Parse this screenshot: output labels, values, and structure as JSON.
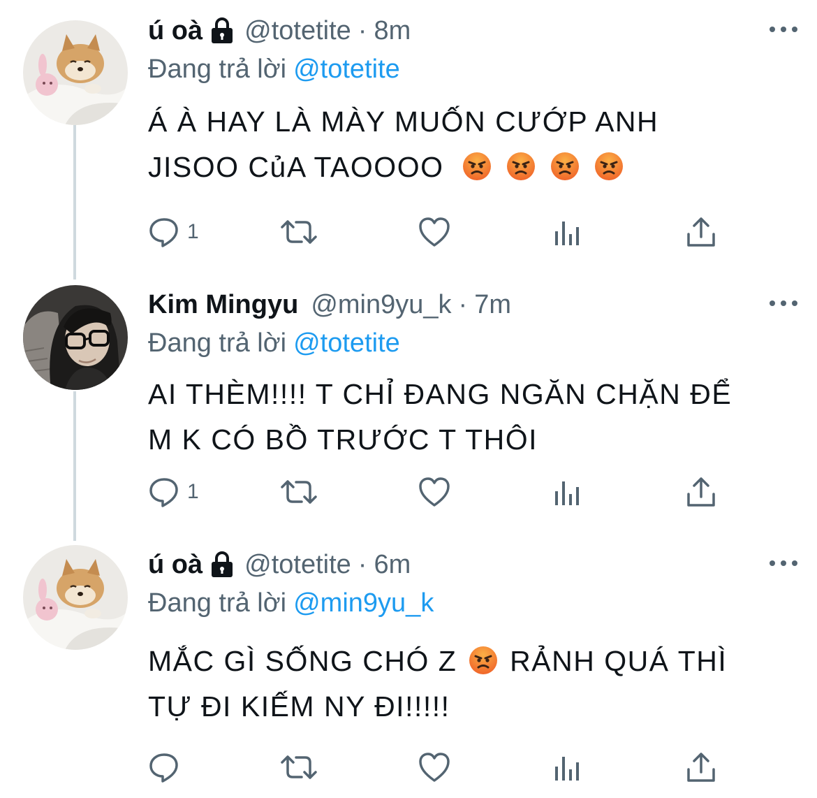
{
  "tweets": [
    {
      "name": "ú oà",
      "handle": "@totetite",
      "separator": "·",
      "time": "8m",
      "replying_prefix": "Đang trả lời",
      "replying_to": "@totetite",
      "text_line1": "Á À HAY LÀ MÀY MUỐN CƯỚP ANH",
      "text_line2": "JISOO CủA TAOOOO",
      "reply_count": "1",
      "avatar": "shiba-dog-avatar",
      "locked": true
    },
    {
      "name": "Kim Mingyu",
      "handle": "@min9yu_k",
      "separator": "·",
      "time": "7m",
      "replying_prefix": "Đang trả lời",
      "replying_to": "@totetite",
      "text_line1": "AI THÈM!!!! T CHỈ ĐANG NGĂN CHẶN ĐỂ",
      "text_line2": "M K CÓ BỒ TRƯỚC T THÔI",
      "reply_count": "1",
      "avatar": "man-with-glasses-avatar",
      "locked": false
    },
    {
      "name": "ú oà",
      "handle": "@totetite",
      "separator": "·",
      "time": "6m",
      "replying_prefix": "Đang trả lời",
      "replying_to": "@min9yu_k",
      "text_line1a": "MẮC GÌ SỐNG CHÓ Z",
      "text_line1b": "RẢNH QUÁ THÌ",
      "text_line2": "TỰ ĐI KIẾM NY ĐI!!!!!",
      "reply_count": "",
      "avatar": "shiba-dog-avatar",
      "locked": true
    }
  ],
  "colors": {
    "text": "#0f1419",
    "secondary": "#536471",
    "link": "#1d9bf0",
    "thread_line": "#cfd9de"
  },
  "icons": [
    "lock-icon",
    "more-icon",
    "reply-icon",
    "retweet-icon",
    "like-icon",
    "analytics-icon",
    "share-icon",
    "angry-face-emoji"
  ]
}
